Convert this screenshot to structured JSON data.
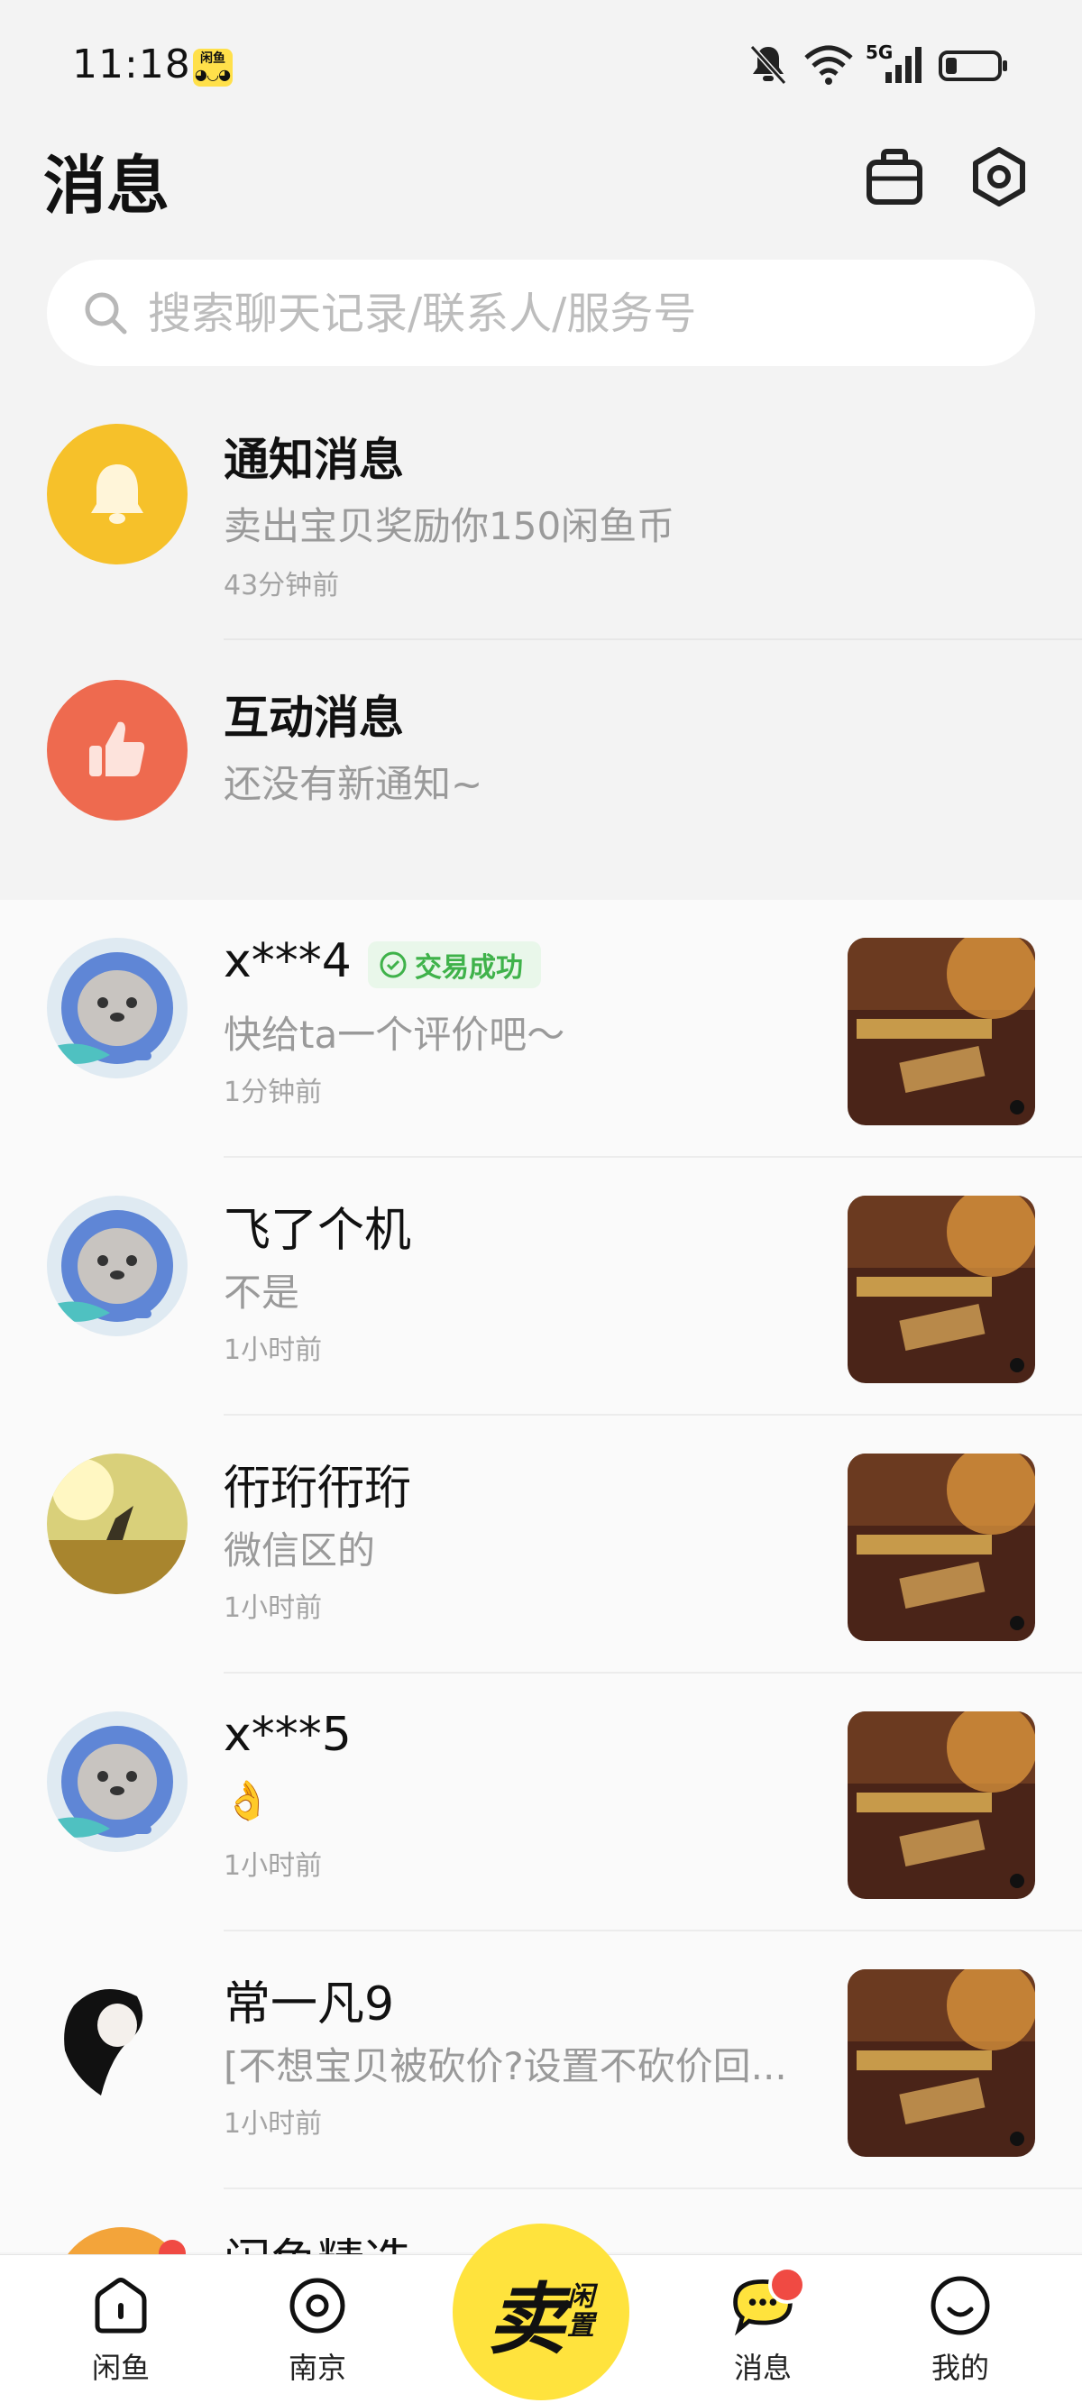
{
  "status_bar": {
    "time": "11:18",
    "app_badge_text": "闲鱼",
    "network": "5G"
  },
  "header": {
    "title": "消息"
  },
  "search": {
    "placeholder": "搜索聊天记录/联系人/服务号"
  },
  "system_messages": [
    {
      "title": "通知消息",
      "subtitle": "卖出宝贝奖励你150闲鱼币",
      "time": "43分钟前",
      "icon": "bell-icon",
      "color": "#f6c12a"
    },
    {
      "title": "互动消息",
      "subtitle": "还没有新通知~",
      "time": "",
      "icon": "thumbs-up-icon",
      "color": "#ee6a4f"
    }
  ],
  "conversations": [
    {
      "name": "x***4",
      "badge": "交易成功",
      "message": "快给ta一个评价吧～",
      "time": "1分钟前",
      "avatar": "seal-avatar"
    },
    {
      "name": "飞了个机",
      "message": "不是",
      "time": "1小时前",
      "avatar": "seal-avatar"
    },
    {
      "name": "衎珩衎珩",
      "message": "微信区的",
      "time": "1小时前",
      "avatar": "field-photo-avatar"
    },
    {
      "name": "x***5",
      "message": "👌",
      "time": "1小时前",
      "avatar": "seal-avatar"
    },
    {
      "name": "常一凡9",
      "message": "[不想宝贝被砍价?设置不砍价回...",
      "time": "1小时前",
      "avatar": "anime-avatar"
    }
  ],
  "peek_row": {
    "title": "闲鱼精选"
  },
  "bottom_nav": {
    "items": [
      {
        "label": "闲鱼",
        "icon": "home-icon"
      },
      {
        "label": "南京",
        "icon": "location-icon"
      },
      {
        "label": "消息",
        "icon": "chat-bubble-icon",
        "badge": true
      },
      {
        "label": "我的",
        "icon": "smile-icon"
      }
    ],
    "sell": {
      "main": "卖",
      "side_top": "闲",
      "side_bottom": "置"
    }
  },
  "colors": {
    "brand_yellow": "#ffe33d",
    "badge_red": "#f04a43",
    "success_green": "#3fb24a"
  }
}
